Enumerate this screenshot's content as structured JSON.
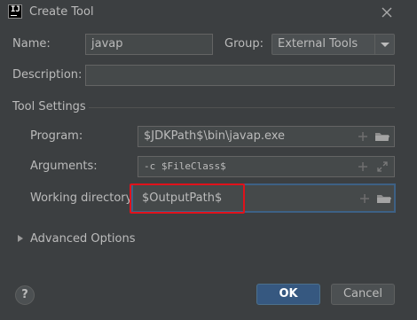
{
  "window": {
    "title": "Create Tool",
    "app_icon_text": "IJ",
    "close_icon": "close-icon"
  },
  "form": {
    "name_label": "Name:",
    "name_value": "javap",
    "group_label": "Group:",
    "group_value": "External Tools",
    "description_label": "Description:",
    "description_value": ""
  },
  "tool_settings": {
    "title": "Tool Settings",
    "program_label": "Program:",
    "program_value": "$JDKPath$\\bin\\javap.exe",
    "arguments_label": "Arguments:",
    "arguments_value": "-c $FileClass$",
    "working_dir_label": "Working directory:",
    "working_dir_value": "$OutputPath$"
  },
  "advanced": {
    "label": "Advanced Options"
  },
  "buttons": {
    "help": "?",
    "ok": "OK",
    "cancel": "Cancel"
  },
  "colors": {
    "background": "#3c3f41",
    "field": "#45494a",
    "ok_button": "#365880",
    "focus_border": "#3d6185",
    "highlight_box": "#e0121b"
  }
}
